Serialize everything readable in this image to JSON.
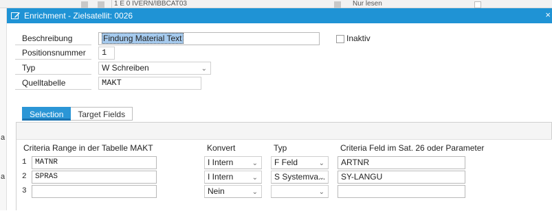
{
  "background": {
    "top_text": "1  E  0  IVERN/IBBCAT03",
    "right_text": "Nur lesen",
    "left_letters": [
      "a",
      "a"
    ]
  },
  "dialog": {
    "title": "Enrichment - Zielsatellit: 0026",
    "close_glyph": "×",
    "fields": {
      "beschreibung_label": "Beschreibung",
      "beschreibung_value": "Findung Material Text",
      "positionsnummer_label": "Positionsnummer",
      "positionsnummer_value": "1",
      "typ_label": "Typ",
      "typ_value": "W Schreiben",
      "quelltabelle_label": "Quelltabelle",
      "quelltabelle_value": "MAKT",
      "inaktiv_label": "Inaktiv"
    },
    "tabs": [
      {
        "label": "Selection",
        "active": true
      },
      {
        "label": "Target Fields",
        "active": false
      }
    ],
    "table": {
      "headers": {
        "criteria_range": "Criteria Range in der Tabelle MAKT",
        "konvert": "Konvert",
        "typ": "Typ",
        "criteria_feld": "Criteria Feld im Sat. 26 oder Parameter"
      },
      "rows": [
        {
          "num": "1",
          "field": "MATNR",
          "konvert": "I Intern",
          "typ": "F Feld",
          "param": "ARTNR"
        },
        {
          "num": "2",
          "field": "SPRAS",
          "konvert": "I Intern",
          "typ": "S Systemva...",
          "param": "SY-LANGU"
        },
        {
          "num": "3",
          "field": "",
          "konvert": "Nein",
          "typ": "",
          "param": ""
        }
      ]
    }
  },
  "colors": {
    "titlebar": "#1f93d5",
    "active_tab": "#2b96d6"
  }
}
